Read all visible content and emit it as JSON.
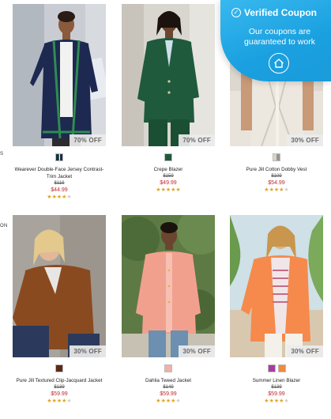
{
  "side_labels": [
    "S",
    "ON"
  ],
  "coupon": {
    "title": "Verified Coupon",
    "subtitle": "Our coupons are guaranteed to work",
    "check_icon": "check-circle-icon",
    "home_icon": "home-icon"
  },
  "products": [
    {
      "name": "Wearever Double-Face Jersey Contrast-Trim Jacket",
      "original_price": "$119",
      "sale_price": "$44.99",
      "badge": "70% OFF",
      "swatches": [
        [
          "#1e2a4a",
          "#2c7a48"
        ]
      ],
      "rating": 4
    },
    {
      "name": "Crepe Blazer",
      "original_price": "$159",
      "sale_price": "$49.99",
      "badge": "70% OFF",
      "swatches": [
        [
          "#1f5a3c"
        ]
      ],
      "rating": 5
    },
    {
      "name": "Pure Jill Cotton Dobby Vest",
      "original_price": "$109",
      "sale_price": "$54.99",
      "badge": "30% OFF",
      "swatches": [
        [
          "#d9d3c8",
          "#9a9590"
        ]
      ],
      "rating": 4
    },
    {
      "name": "Pure Jill Textured Clip-Jacquard Jacket",
      "original_price": "$139",
      "sale_price": "$59.99",
      "badge": "30% OFF",
      "swatches": [
        [
          "#5c2a14"
        ]
      ],
      "rating": 4
    },
    {
      "name": "Dahlia Tweed Jacket",
      "original_price": "$149",
      "sale_price": "$59.99",
      "badge": "30% OFF",
      "swatches": [
        [
          "#f2b0a6"
        ]
      ],
      "rating": 4
    },
    {
      "name": "Summer Linen Blazer",
      "original_price": "$139",
      "sale_price": "$59.99",
      "badge": "30% OFF",
      "swatches": [
        [
          "#a63ea0"
        ],
        [
          "#f08a3c"
        ]
      ],
      "rating": 4
    }
  ]
}
